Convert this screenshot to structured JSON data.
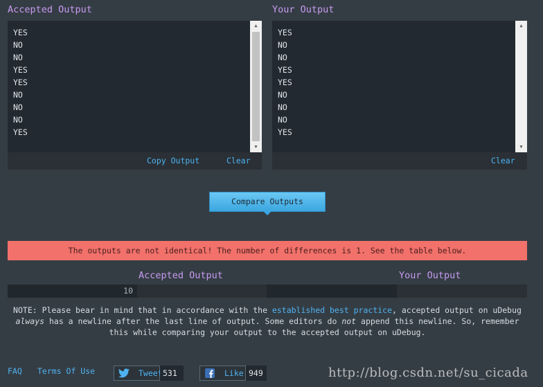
{
  "accepted": {
    "title": "Accepted Output",
    "lines": [
      "YES",
      "NO",
      "NO",
      "YES",
      "YES",
      "NO",
      "NO",
      "NO",
      "YES"
    ],
    "copy_label": "Copy Output",
    "clear_label": "Clear"
  },
  "yours": {
    "title": "Your Output",
    "lines": [
      "YES",
      "NO",
      "NO",
      "YES",
      "YES",
      "NO",
      "NO",
      "NO",
      "YES"
    ],
    "clear_label": "Clear"
  },
  "compare_label": "Compare Outputs",
  "banner_text": "The outputs are not identical! The number of differences is 1. See the table below.",
  "diff_table": {
    "accepted_header": "Accepted Output",
    "your_header": "Your Output",
    "rows": [
      {
        "line_number": "10",
        "accepted": "",
        "yours": ""
      }
    ]
  },
  "note": {
    "part1": "NOTE: Please bear in mind that in accordance with the ",
    "link": "established best practice",
    "part2": ", accepted output on uDebug ",
    "em1": "always",
    "part3": " has a newline after the last line of output. Some editors do ",
    "em2": "not",
    "part4": " append this newline. So, remember this while comparing your output to the accepted output on uDebug."
  },
  "footer": {
    "faq": "FAQ",
    "terms": "Terms Of Use",
    "tweet_label": "Tweet",
    "tweet_count": "531",
    "like_label": "Like",
    "like_count": "949",
    "watermark": "http://blog.csdn.net/su_cicada"
  },
  "colors": {
    "background": "#353d44",
    "title_purple": "#c79bf2",
    "link_blue": "#4fb3f2",
    "banner": "#f2716b",
    "button": "#3aa6e0"
  }
}
